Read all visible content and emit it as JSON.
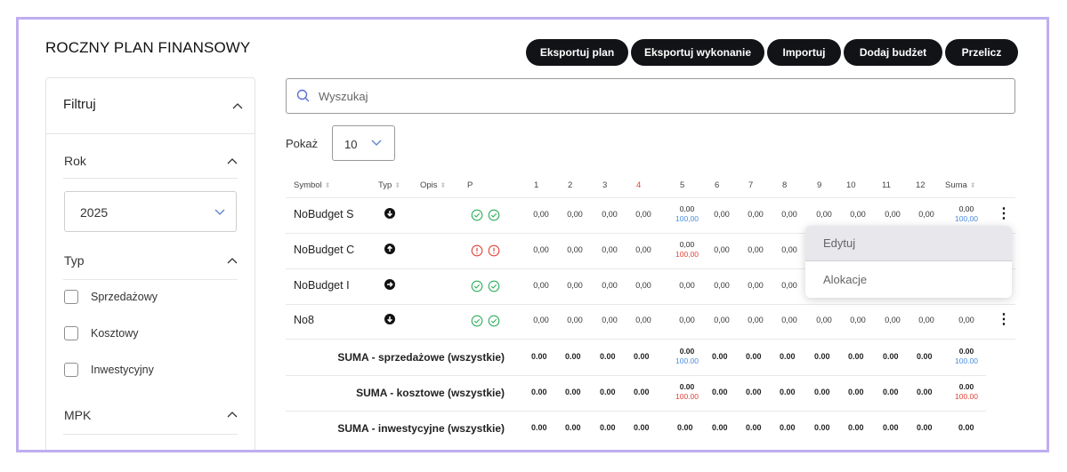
{
  "title": "ROCZNY PLAN FINANSOWY",
  "buttons": [
    {
      "label": "Eksportuj plan"
    },
    {
      "label": "Eksportuj wykonanie"
    },
    {
      "label": "Importuj"
    },
    {
      "label": "Dodaj budżet"
    },
    {
      "label": "Przelicz"
    }
  ],
  "filters": {
    "header": "Filtruj",
    "rok_label": "Rok",
    "rok_value": "2025",
    "typ_label": "Typ",
    "typ_options": [
      "Sprzedażowy",
      "Kosztowy",
      "Inwestycyjny"
    ],
    "mpk_label": "MPK"
  },
  "search": {
    "placeholder": "Wyszukaj"
  },
  "show": {
    "label": "Pokaż",
    "value": "10"
  },
  "table": {
    "headers": {
      "symbol": "Symbol",
      "typ": "Typ",
      "opis": "Opis",
      "p": "P",
      "months": [
        "1",
        "2",
        "3",
        "4",
        "5",
        "6",
        "7",
        "8",
        "9",
        "10",
        "11",
        "12"
      ],
      "suma": "Suma"
    },
    "rows": [
      {
        "symbol": "NoBudget S",
        "typ_icon": "arrow-down-circle-icon",
        "status": "ok",
        "months": [
          "0,00",
          "0,00",
          "0,00",
          "0,00",
          "0,00",
          "0,00",
          "0,00",
          "0,00",
          "0,00",
          "0,00",
          "0,00",
          "0,00"
        ],
        "m5_sub": "100,00",
        "m5_sub_color": "blue",
        "suma": "0,00",
        "suma_sub": "100,00",
        "suma_sub_color": "blue"
      },
      {
        "symbol": "NoBudget C",
        "typ_icon": "arrow-up-circle-icon",
        "status": "warn",
        "months": [
          "0,00",
          "0,00",
          "0,00",
          "0,00",
          "0,00",
          "0,00",
          "0,00",
          "0,00",
          "",
          "",
          "",
          ""
        ],
        "m5_sub": "100,00",
        "m5_sub_color": "red",
        "suma": "",
        "suma_sub": "",
        "suma_sub_color": ""
      },
      {
        "symbol": "NoBudget I",
        "typ_icon": "arrow-right-circle-icon",
        "status": "ok",
        "months": [
          "0,00",
          "0,00",
          "0,00",
          "0,00",
          "0,00",
          "0,00",
          "0,00",
          "0,00",
          "",
          "",
          "",
          ""
        ],
        "m5_sub": "",
        "m5_sub_color": "",
        "suma": "",
        "suma_sub": "",
        "suma_sub_color": ""
      },
      {
        "symbol": "No8",
        "typ_icon": "arrow-down-circle-icon",
        "status": "ok",
        "months": [
          "0,00",
          "0,00",
          "0,00",
          "0,00",
          "0,00",
          "0,00",
          "0,00",
          "0,00",
          "0,00",
          "0,00",
          "0,00",
          "0,00"
        ],
        "m5_sub": "",
        "m5_sub_color": "",
        "suma": "0,00",
        "suma_sub": "",
        "suma_sub_color": ""
      }
    ],
    "sums": [
      {
        "label": "SUMA - sprzedażowe (wszystkie)",
        "months": [
          "0.00",
          "0.00",
          "0.00",
          "0.00",
          "0.00",
          "0.00",
          "0.00",
          "0.00",
          "0.00",
          "0.00",
          "0.00",
          "0.00"
        ],
        "m5_sub": "100.00",
        "m5_sub_color": "blue",
        "suma": "0.00",
        "suma_sub": "100.00",
        "suma_sub_color": "blue"
      },
      {
        "label": "SUMA - kosztowe (wszystkie)",
        "months": [
          "0.00",
          "0.00",
          "0.00",
          "0.00",
          "0.00",
          "0.00",
          "0.00",
          "0.00",
          "0.00",
          "0.00",
          "0.00",
          "0.00"
        ],
        "m5_sub": "100.00",
        "m5_sub_color": "red",
        "suma": "0.00",
        "suma_sub": "100.00",
        "suma_sub_color": "red"
      },
      {
        "label": "SUMA - inwestycyjne (wszystkie)",
        "months": [
          "0.00",
          "0.00",
          "0.00",
          "0.00",
          "0.00",
          "0.00",
          "0.00",
          "0.00",
          "0.00",
          "0.00",
          "0.00",
          "0.00"
        ],
        "m5_sub": "",
        "m5_sub_color": "",
        "suma": "0.00",
        "suma_sub": "",
        "suma_sub_color": ""
      }
    ]
  },
  "context_menu": {
    "items": [
      "Edytuj",
      "Alokacje"
    ]
  },
  "colors": {
    "accent_border": "#bfaef0",
    "button_bg": "#111317",
    "ok": "#2fae5b",
    "warn": "#e0443a",
    "blue": "#4b8ee0"
  }
}
